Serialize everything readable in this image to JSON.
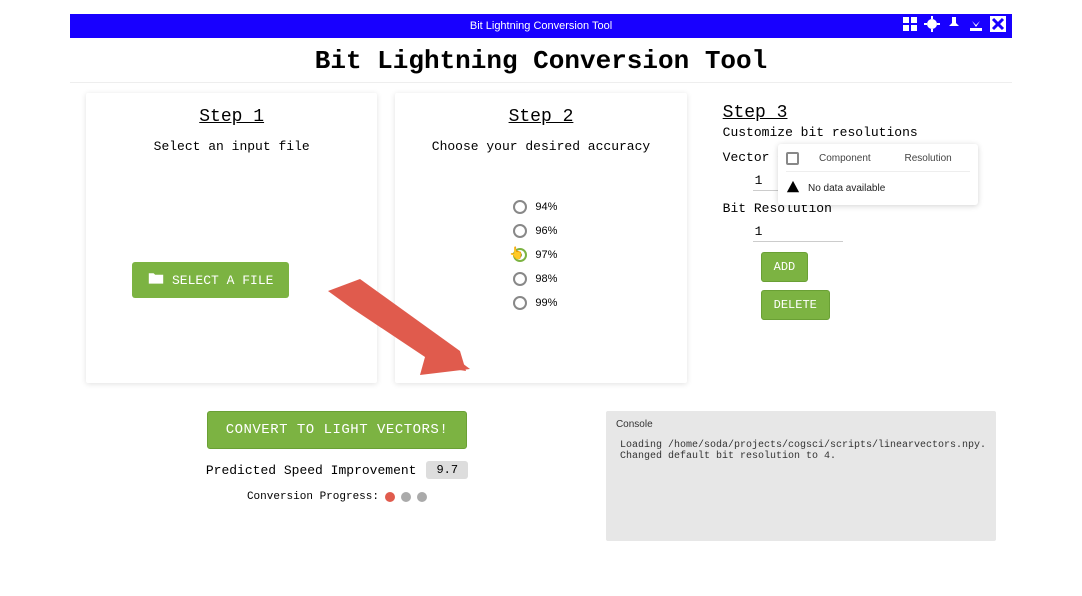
{
  "header": {
    "title": "Bit Lightning Conversion Tool"
  },
  "page_title": "Bit Lightning Conversion Tool",
  "step1": {
    "title": "Step 1",
    "subtitle": "Select an input file",
    "button": "SELECT A FILE"
  },
  "step2": {
    "title": "Step 2",
    "subtitle": "Choose your desired accuracy",
    "options": [
      "94%",
      "96%",
      "97%",
      "98%",
      "99%"
    ],
    "selected_index": 2
  },
  "step3": {
    "title": "Step 3",
    "subtitle": "Customize bit resolutions",
    "vector_label": "Vector Component",
    "vector_value": "1",
    "bit_label": "Bit Resolution",
    "bit_value": "1",
    "add_label": "ADD",
    "delete_label": "DELETE",
    "table": {
      "col1": "Component",
      "col2": "Resolution",
      "empty": "No data available"
    }
  },
  "convert_label": "CONVERT TO LIGHT VECTORS!",
  "psi": {
    "label": "Predicted Speed Improvement",
    "value": "9.7"
  },
  "progress_label": "Conversion Progress:",
  "console": {
    "title": "Console",
    "lines": [
      "Loading /home/soda/projects/cogsci/scripts/linearvectors.npy.",
      "Changed default bit resolution to 4."
    ]
  }
}
